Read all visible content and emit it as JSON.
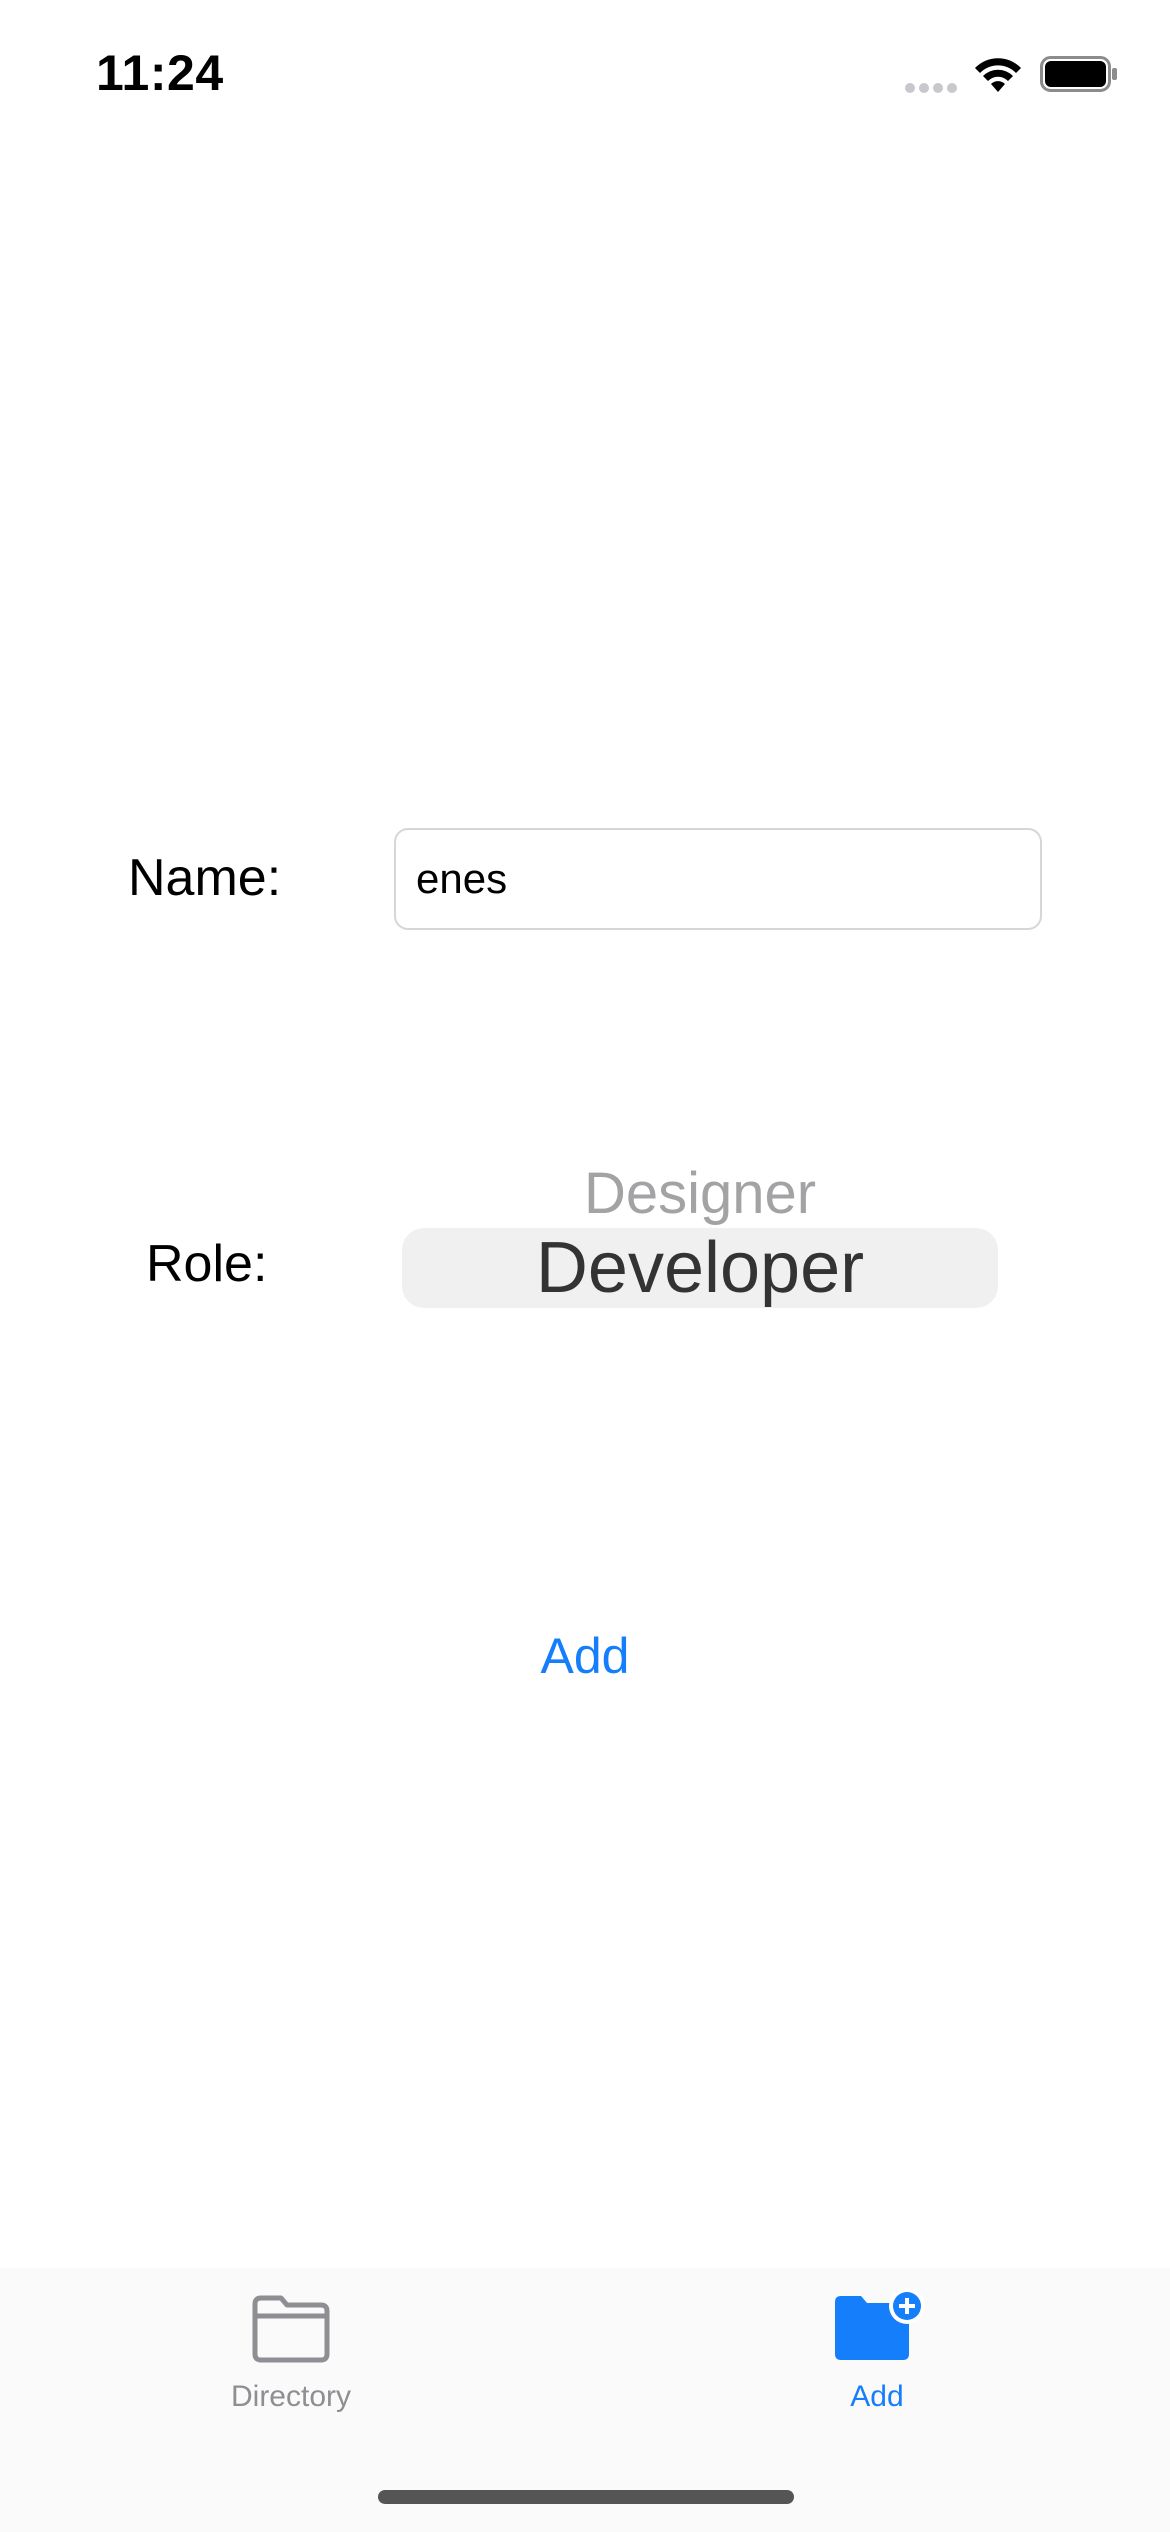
{
  "status_bar": {
    "time": "11:24",
    "wifi_icon": "wifi-icon",
    "battery_icon": "battery-icon"
  },
  "form": {
    "name_label": "Name:",
    "name_value": "enes",
    "role_label": "Role:",
    "role_options_visible": [
      "Designer",
      "Developer"
    ],
    "role_selected": "Developer",
    "add_button_label": "Add"
  },
  "tab_bar": {
    "tabs": [
      {
        "label": "Directory",
        "icon": "folder-icon",
        "selected": false
      },
      {
        "label": "Add",
        "icon": "folder-plus-icon",
        "selected": true
      }
    ]
  },
  "colors": {
    "accent": "#147efb",
    "inactive_tab": "#8e8e93",
    "picker_highlight": "#f0f0f1"
  }
}
